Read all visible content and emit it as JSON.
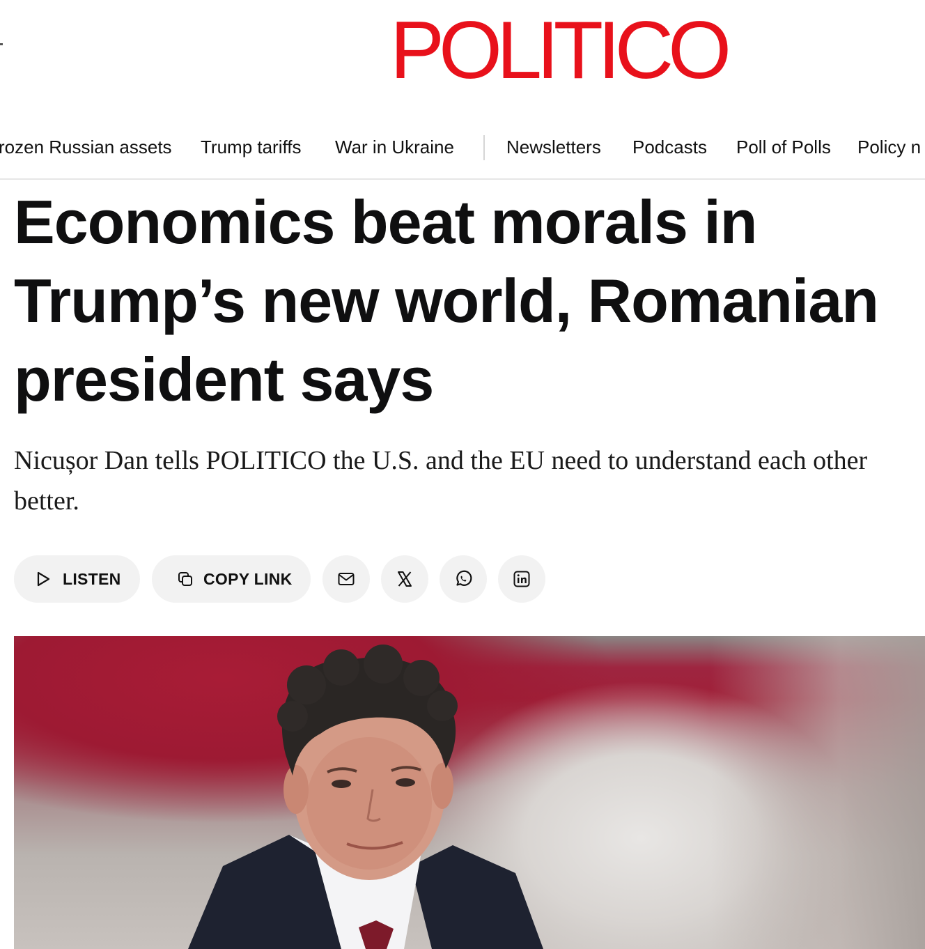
{
  "brand": {
    "logo_text": "POLITICO",
    "color": "#e8111b"
  },
  "nav": {
    "topics": [
      {
        "label": "rozen Russian assets"
      },
      {
        "label": "Trump tariffs"
      },
      {
        "label": "War in Ukraine"
      }
    ],
    "sections": [
      {
        "label": "Newsletters"
      },
      {
        "label": "Podcasts"
      },
      {
        "label": "Poll of Polls"
      },
      {
        "label": "Policy n"
      }
    ]
  },
  "article": {
    "headline": "Economics beat morals in Trump’s new world, Romanian president says",
    "dek": "Nicușor Dan tells POLITICO the U.S. and the EU need to understand each other better."
  },
  "actions": {
    "listen": {
      "label": "LISTEN",
      "icon": "play-icon"
    },
    "copy_link": {
      "label": "COPY LINK",
      "icon": "copy-icon"
    },
    "share": [
      {
        "icon": "mail-icon"
      },
      {
        "icon": "x-logo-icon"
      },
      {
        "icon": "whatsapp-icon"
      },
      {
        "icon": "linkedin-icon"
      }
    ]
  },
  "colors": {
    "button_bg": "#f2f2f2",
    "text": "#111111"
  }
}
